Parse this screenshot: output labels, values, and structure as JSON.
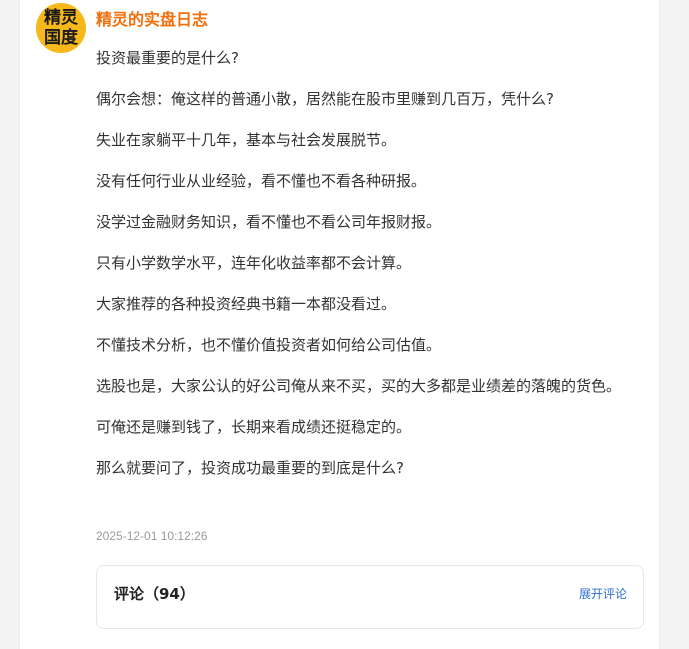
{
  "post": {
    "avatar_text_line1": "精灵",
    "avatar_text_line2": "国度",
    "author": "精灵的实盘日志",
    "paragraphs": [
      "投资最重要的是什么?",
      "偶尔会想：俺这样的普通小散，居然能在股市里赚到几百万，凭什么?",
      "失业在家躺平十几年，基本与社会发展脱节。",
      "没有任何行业从业经验，看不懂也不看各种研报。",
      "没学过金融财务知识，看不懂也不看公司年报财报。",
      "只有小学数学水平，连年化收益率都不会计算。",
      "大家推荐的各种投资经典书籍一本都没看过。",
      "不懂技术分析，也不懂价值投资者如何给公司估值。",
      "选股也是，大家公认的好公司俺从来不买，买的大多都是业绩差的落魄的货色。",
      "可俺还是赚到钱了，长期来看成绩还挺稳定的。",
      "那么就要问了，投资成功最重要的到底是什么?"
    ],
    "timestamp": "2025-12-01 10:12:26"
  },
  "comments": {
    "title": "评论（94）",
    "expand_label": "展开评论"
  },
  "colors": {
    "author": "#f0700e",
    "avatar_bg": "#f6b81a",
    "link": "#2b6fd6"
  }
}
